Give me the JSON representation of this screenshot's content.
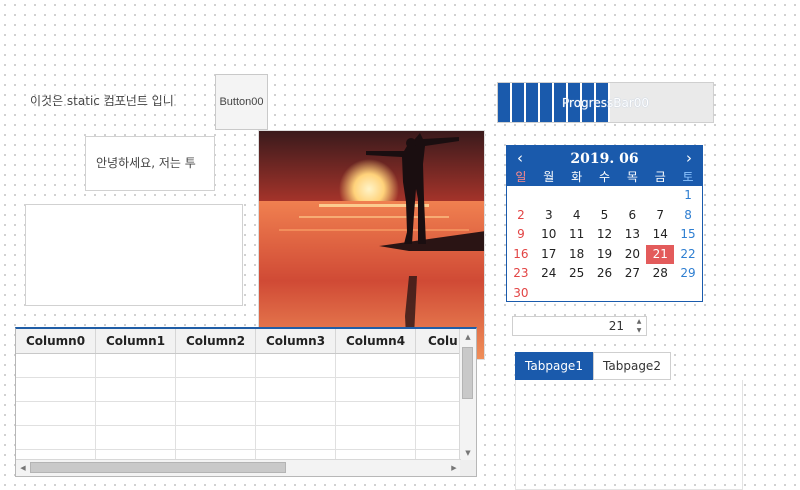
{
  "static_text": "이것은 static 컴포넌트 입니",
  "button": {
    "label": "Button00"
  },
  "edit": {
    "value": "안녕하세요, 저는 투"
  },
  "grid": {
    "columns": [
      "Column0",
      "Column1",
      "Column2",
      "Column3",
      "Column4",
      "Colu"
    ]
  },
  "progress": {
    "label": "ProgressBar00",
    "value_fraction": 0.53
  },
  "calendar": {
    "title": "2019.  06",
    "prev_symbol": "‹",
    "next_symbol": "›",
    "weekdays": [
      "일",
      "월",
      "화",
      "수",
      "목",
      "금",
      "토"
    ],
    "days": [
      "",
      "",
      "",
      "",
      "",
      "",
      "1",
      "2",
      "3",
      "4",
      "5",
      "6",
      "7",
      "8",
      "9",
      "10",
      "11",
      "12",
      "13",
      "14",
      "15",
      "16",
      "17",
      "18",
      "19",
      "20",
      "21",
      "22",
      "23",
      "24",
      "25",
      "26",
      "27",
      "28",
      "29",
      "30",
      "",
      "",
      "",
      "",
      "",
      ""
    ],
    "selected": "21"
  },
  "spin": {
    "value": "21"
  },
  "tabs": [
    {
      "label": "Tabpage1"
    },
    {
      "label": "Tabpage2"
    }
  ],
  "colors": {
    "accent": "#1a5aac",
    "sunday": "#e24444",
    "saturday": "#2e7ed1",
    "selected_day": "#e35b5b"
  }
}
